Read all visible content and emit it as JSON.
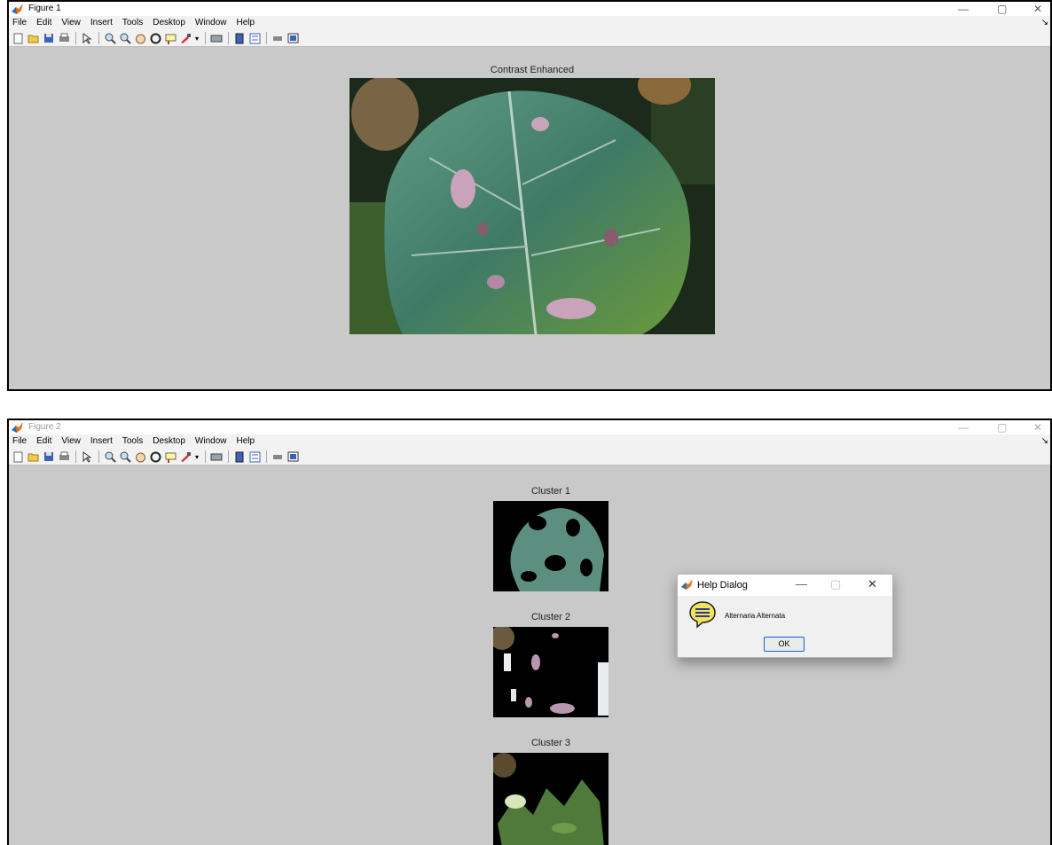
{
  "figure1": {
    "title": "Figure 1",
    "menu": [
      "File",
      "Edit",
      "View",
      "Insert",
      "Tools",
      "Desktop",
      "Window",
      "Help"
    ],
    "axes_title": "Contrast Enhanced"
  },
  "figure2": {
    "title": "Figure 2",
    "menu": [
      "File",
      "Edit",
      "View",
      "Insert",
      "Tools",
      "Desktop",
      "Window",
      "Help"
    ],
    "clusters": [
      "Cluster 1",
      "Cluster 2",
      "Cluster 3"
    ]
  },
  "dialog": {
    "title": "Help Dialog",
    "message": "Alternaria Alternata",
    "ok_label": "OK"
  },
  "colors": {
    "figure_bg": "#c9c9c9",
    "dialog_accent": "#0a64d8",
    "matlab_logo": "#e8731a"
  },
  "toolbar_icons": [
    "new-figure-icon",
    "open-icon",
    "save-icon",
    "print-icon",
    "select-arrow-icon",
    "zoom-in-icon",
    "zoom-out-icon",
    "pan-icon",
    "rotate-3d-icon",
    "data-cursor-icon",
    "brush-icon",
    "link-icon",
    "colorbar-icon",
    "legend-icon",
    "hide-plot-tools-icon",
    "show-plot-tools-icon"
  ]
}
